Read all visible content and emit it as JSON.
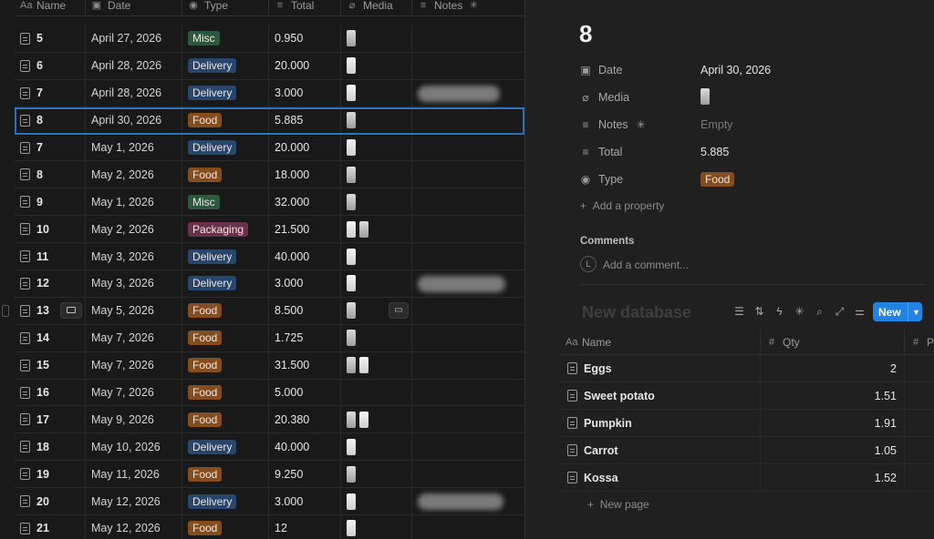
{
  "table": {
    "columns": [
      {
        "label": "Name",
        "icon": "Aa"
      },
      {
        "label": "Date",
        "icon": "calendar-icon"
      },
      {
        "label": "Type",
        "icon": "select-icon"
      },
      {
        "label": "Total",
        "icon": "text-icon"
      },
      {
        "label": "Media",
        "icon": "paperclip-icon"
      },
      {
        "label": "Notes",
        "icon": "text-icon"
      }
    ],
    "rows": [
      {
        "name": "5",
        "date": "April 27, 2026",
        "type": "Misc",
        "total": "0.950"
      },
      {
        "name": "6",
        "date": "April 28, 2026",
        "type": "Delivery",
        "total": "20.000"
      },
      {
        "name": "7",
        "date": "April 28, 2026",
        "type": "Delivery",
        "total": "3.000"
      },
      {
        "name": "8",
        "date": "April 30, 2026",
        "type": "Food",
        "total": "5.885"
      },
      {
        "name": "7",
        "date": "May 1, 2026",
        "type": "Delivery",
        "total": "20.000"
      },
      {
        "name": "8",
        "date": "May 2, 2026",
        "type": "Food",
        "total": "18.000"
      },
      {
        "name": "9",
        "date": "May 1, 2026",
        "type": "Misc",
        "total": "32.000"
      },
      {
        "name": "10",
        "date": "May 2, 2026",
        "type": "Packaging",
        "total": "21.500"
      },
      {
        "name": "11",
        "date": "May 3, 2026",
        "type": "Delivery",
        "total": "40.000"
      },
      {
        "name": "12",
        "date": "May 3, 2026",
        "type": "Delivery",
        "total": "3.000"
      },
      {
        "name": "13",
        "date": "May 5, 2026",
        "type": "Food",
        "total": "8.500"
      },
      {
        "name": "14",
        "date": "May 7, 2026",
        "type": "Food",
        "total": "1.725"
      },
      {
        "name": "15",
        "date": "May 7, 2026",
        "type": "Food",
        "total": "31.500"
      },
      {
        "name": "16",
        "date": "May 7, 2026",
        "type": "Food",
        "total": "5.000"
      },
      {
        "name": "17",
        "date": "May 9, 2026",
        "type": "Food",
        "total": "20.380"
      },
      {
        "name": "18",
        "date": "May 10, 2026",
        "type": "Delivery",
        "total": "40.000"
      },
      {
        "name": "19",
        "date": "May 11, 2026",
        "type": "Food",
        "total": "9.250"
      },
      {
        "name": "20",
        "date": "May 12, 2026",
        "type": "Delivery",
        "total": "3.000"
      },
      {
        "name": "21",
        "date": "May 12, 2026",
        "type": "Food",
        "total": "12"
      }
    ]
  },
  "tag_colors": {
    "Misc": "#2b593f",
    "Delivery": "#28456c",
    "Food": "#854c1d",
    "Packaging": "#69314c"
  },
  "detail": {
    "title": "8",
    "props": [
      {
        "label": "Date",
        "value": "April 30, 2026",
        "icon": "calendar-icon"
      },
      {
        "label": "Media",
        "value": "",
        "icon": "paperclip-icon"
      },
      {
        "label": "Notes",
        "value": "Empty",
        "icon": "text-icon"
      },
      {
        "label": "Total",
        "value": "5.885",
        "icon": "text-icon"
      },
      {
        "label": "Type",
        "value": "Food",
        "icon": "select-icon"
      }
    ],
    "add_property": "Add a property",
    "comments_label": "Comments",
    "avatar_initial": "L",
    "add_comment": "Add a comment..."
  },
  "subdb": {
    "title": "New database",
    "new_button": "New",
    "columns": [
      {
        "label": "Name",
        "icon": "Aa"
      },
      {
        "label": "Qty",
        "icon": "#"
      },
      {
        "label": "P",
        "icon": "#"
      }
    ],
    "rows": [
      {
        "name": "Eggs",
        "qty": "2"
      },
      {
        "name": "Sweet potato",
        "qty": "1.51"
      },
      {
        "name": "Pumpkin",
        "qty": "1.91"
      },
      {
        "name": "Carrot",
        "qty": "1.05"
      },
      {
        "name": "Kossa",
        "qty": "1.52"
      }
    ],
    "new_page": "New page"
  }
}
